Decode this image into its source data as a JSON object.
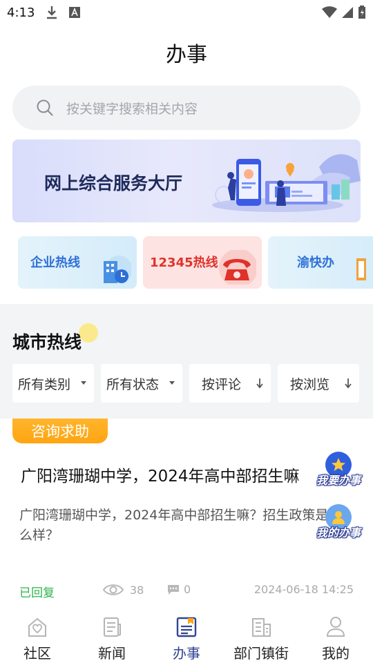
{
  "status_bar": {
    "time": "4:13"
  },
  "header": {
    "title": "办事"
  },
  "search": {
    "placeholder": "按关键字搜索相关内容"
  },
  "banner": {
    "title": "网上综合服务大厅"
  },
  "quick_cards": [
    {
      "label": "企业热线"
    },
    {
      "label": "12345热线"
    },
    {
      "label": "渝快办"
    }
  ],
  "hotline_section": {
    "title": "城市热线",
    "filters": [
      {
        "label": "所有类别",
        "icon": "dropdown-triangle"
      },
      {
        "label": "所有状态",
        "icon": "dropdown-triangle"
      },
      {
        "label": "按评论",
        "icon": "sort-down-arrow"
      },
      {
        "label": "按浏览",
        "icon": "sort-down-arrow"
      }
    ]
  },
  "post": {
    "tag": "咨询求助",
    "title": "广阳湾珊瑚中学，2024年高中部招生嘛",
    "body": "广阳湾珊瑚中学，2024年高中部招生嘛？招生政策是怎么样？",
    "status": "已回复",
    "views": "38",
    "comments": "0",
    "time": "2024-06-18 14:25"
  },
  "floating_buttons": [
    {
      "label": "我要办事"
    },
    {
      "label": "我的办事"
    }
  ],
  "tab_bar": {
    "active": "办事",
    "items": [
      {
        "label": "社区",
        "icon": "community-house-icon"
      },
      {
        "label": "新闻",
        "icon": "news-icon"
      },
      {
        "label": "办事",
        "icon": "affairs-icon"
      },
      {
        "label": "部门镇街",
        "icon": "department-building-icon"
      },
      {
        "label": "我的",
        "icon": "user-icon"
      }
    ]
  },
  "colors": {
    "accent": "#2f4493",
    "tag": "#ffa412",
    "replied": "#2bb34a",
    "hotline_red": "#e0322a",
    "hotline_blue": "#2d6fd6"
  }
}
